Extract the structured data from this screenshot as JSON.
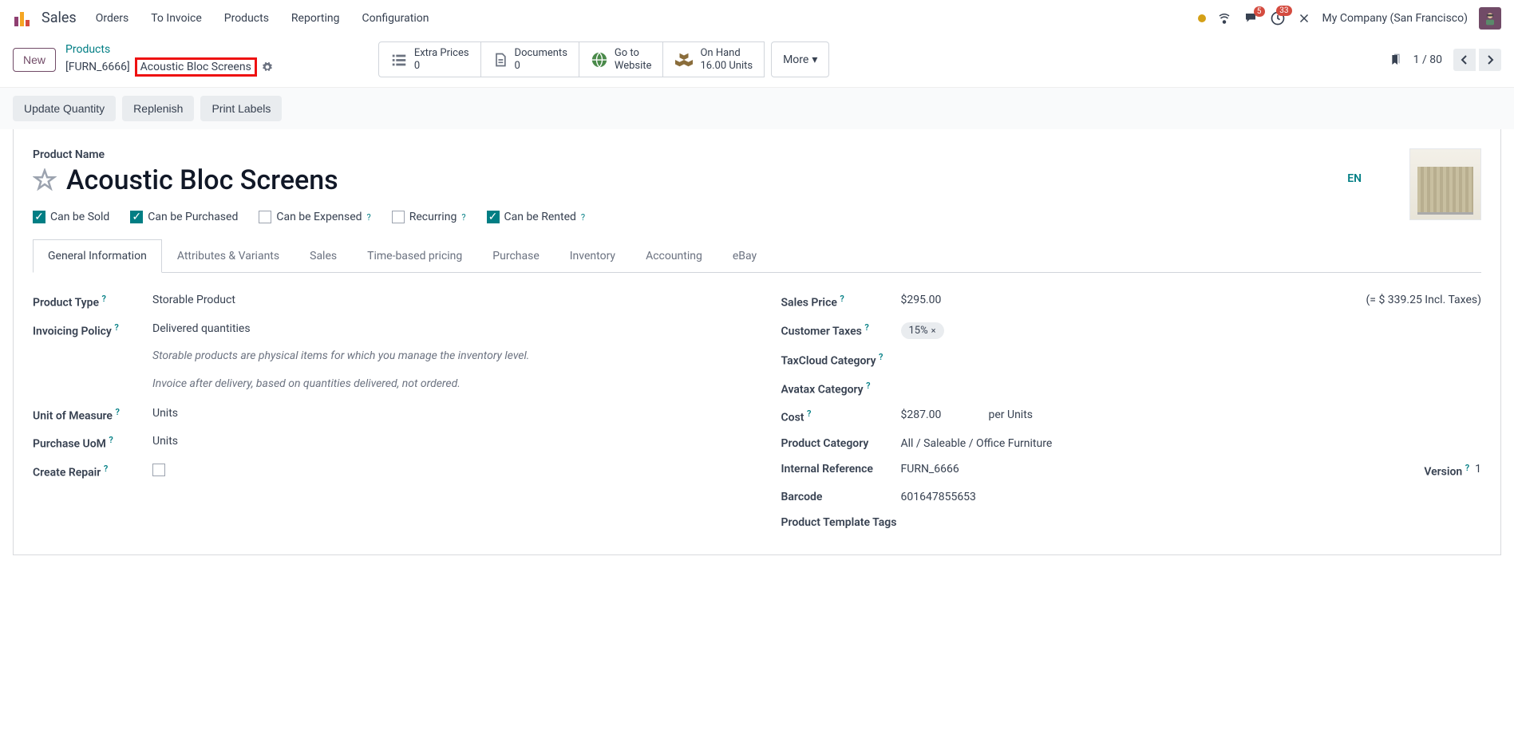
{
  "topbar": {
    "app": "Sales",
    "nav": [
      "Orders",
      "To Invoice",
      "Products",
      "Reporting",
      "Configuration"
    ],
    "msg_badge": "5",
    "activity_badge": "33",
    "company": "My Company (San Francisco)"
  },
  "breadcrumb": {
    "new_btn": "New",
    "parent": "Products",
    "sku": "[FURN_6666]",
    "name": "Acoustic Bloc Screens"
  },
  "stats": {
    "extra_prices": {
      "label": "Extra Prices",
      "value": "0"
    },
    "documents": {
      "label": "Documents",
      "value": "0"
    },
    "website": {
      "label1": "Go to",
      "label2": "Website"
    },
    "onhand": {
      "label": "On Hand",
      "value": "16.00 Units"
    },
    "more": "More"
  },
  "pager": {
    "text": "1 / 80"
  },
  "toolbar": {
    "update_qty": "Update Quantity",
    "replenish": "Replenish",
    "print_labels": "Print Labels"
  },
  "product": {
    "name_label": "Product Name",
    "name": "Acoustic Bloc Screens",
    "lang": "EN"
  },
  "checks": {
    "sold": "Can be Sold",
    "purchased": "Can be Purchased",
    "expensed": "Can be Expensed",
    "recurring": "Recurring",
    "rented": "Can be Rented"
  },
  "tabs": [
    "General Information",
    "Attributes & Variants",
    "Sales",
    "Time-based pricing",
    "Purchase",
    "Inventory",
    "Accounting",
    "eBay"
  ],
  "left_fields": {
    "product_type": {
      "label": "Product Type",
      "value": "Storable Product"
    },
    "invoicing_policy": {
      "label": "Invoicing Policy",
      "value": "Delivered quantities"
    },
    "help1": "Storable products are physical items for which you manage the inventory level.",
    "help2": "Invoice after delivery, based on quantities delivered, not ordered.",
    "uom": {
      "label": "Unit of Measure",
      "value": "Units"
    },
    "purchase_uom": {
      "label": "Purchase UoM",
      "value": "Units"
    },
    "create_repair": {
      "label": "Create Repair"
    }
  },
  "right_fields": {
    "sales_price": {
      "label": "Sales Price",
      "value": "$295.00",
      "extra": "(= $ 339.25 Incl. Taxes)"
    },
    "customer_taxes": {
      "label": "Customer Taxes",
      "tag": "15%"
    },
    "taxcloud": {
      "label": "TaxCloud Category"
    },
    "avatax": {
      "label": "Avatax Category"
    },
    "cost": {
      "label": "Cost",
      "value": "$287.00",
      "unit": "per Units"
    },
    "category": {
      "label": "Product Category",
      "value": "All / Saleable / Office Furniture"
    },
    "internal_ref": {
      "label": "Internal Reference",
      "value": "FURN_6666"
    },
    "version": {
      "label": "Version",
      "value": "1"
    },
    "barcode": {
      "label": "Barcode",
      "value": "601647855653"
    },
    "template_tags": {
      "label": "Product Template Tags"
    }
  }
}
